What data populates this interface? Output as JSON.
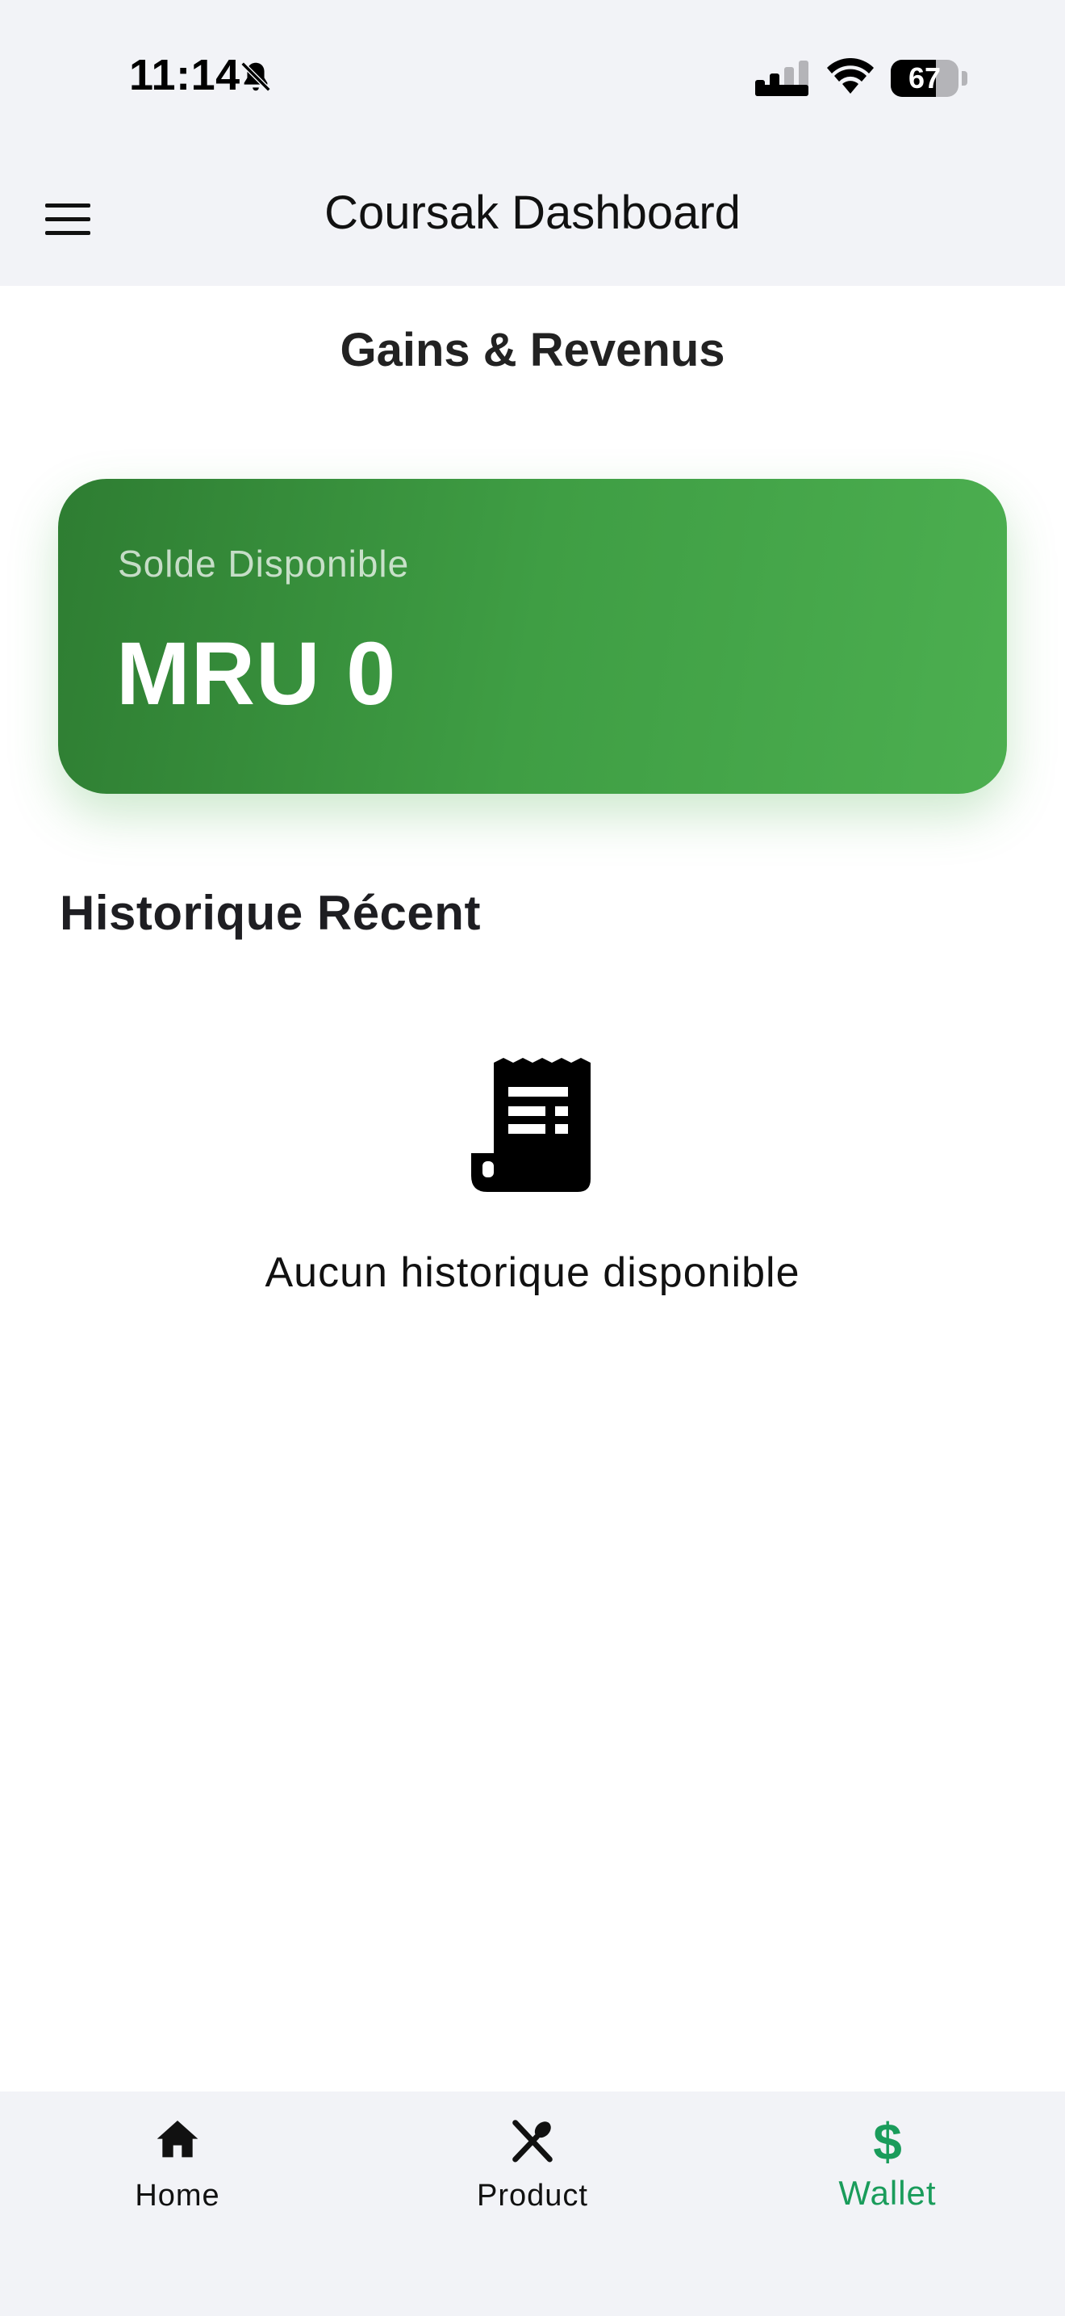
{
  "status_bar": {
    "time": "11:14",
    "battery_level": 67,
    "battery_label": "67",
    "icons": [
      "bell-slash-icon",
      "signal-icon",
      "wifi-icon",
      "battery-icon"
    ]
  },
  "app_bar": {
    "title": "Coursak Dashboard",
    "menu_icon": "hamburger-menu-icon"
  },
  "page": {
    "title": "Gains & Revenus"
  },
  "balance_card": {
    "label": "Solde Disponible",
    "amount": "MRU 0",
    "gradient_start": "#2e7d32",
    "gradient_end": "#4caf50"
  },
  "history": {
    "title": "Historique Récent",
    "empty_icon": "receipt-icon",
    "empty_text": "Aucun historique disponible"
  },
  "bottom_nav": {
    "active_color": "#1a9c5b",
    "items": [
      {
        "label": "Home",
        "icon": "home-icon",
        "active": false
      },
      {
        "label": "Product",
        "icon": "fork-spoon-icon",
        "active": false
      },
      {
        "label": "Wallet",
        "icon": "dollar-icon",
        "active": true
      }
    ]
  }
}
